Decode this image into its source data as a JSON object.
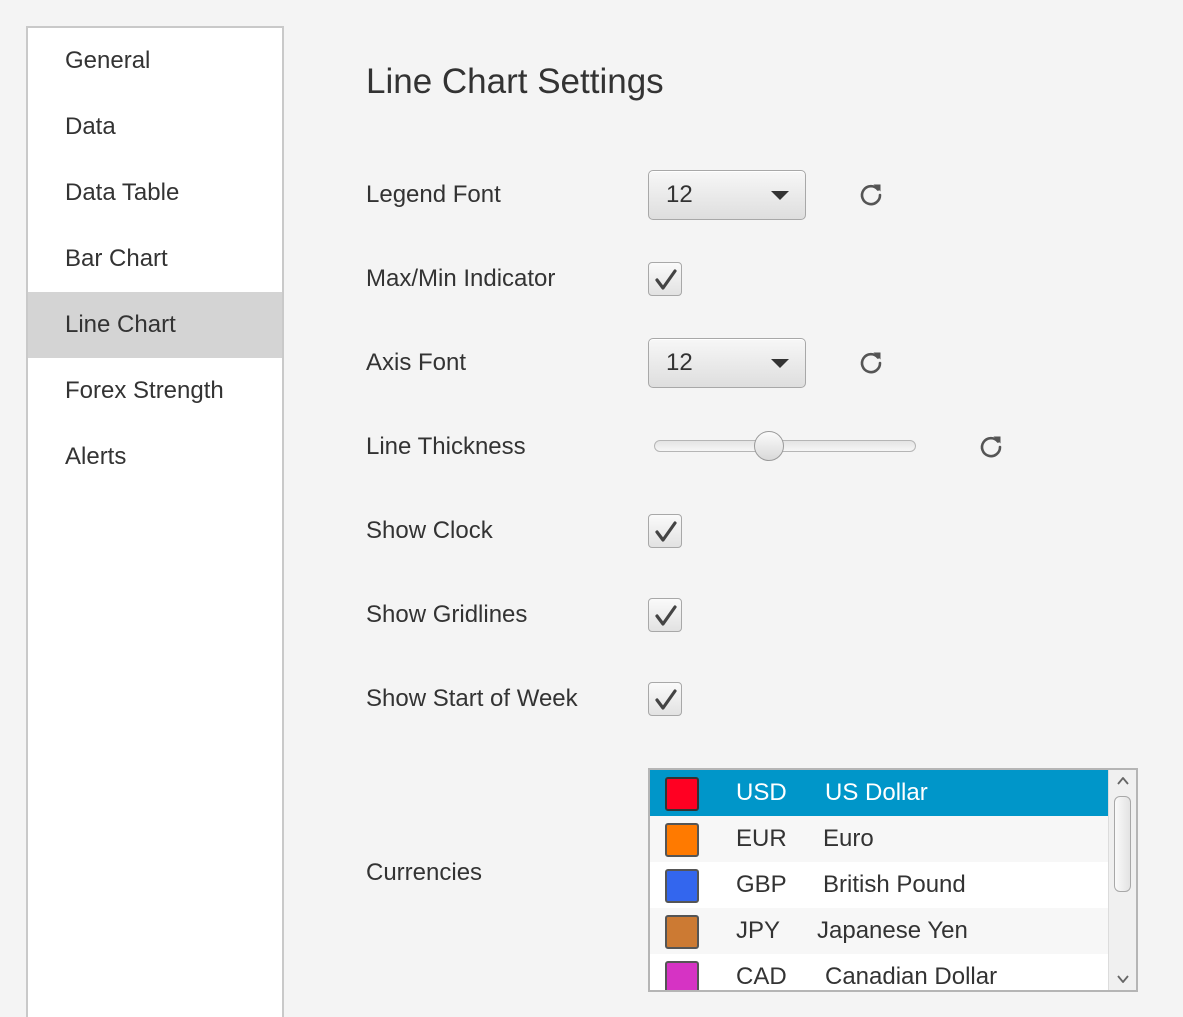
{
  "sidebar": {
    "items": [
      {
        "label": "General",
        "active": false
      },
      {
        "label": "Data",
        "active": false
      },
      {
        "label": "Data Table",
        "active": false
      },
      {
        "label": "Bar Chart",
        "active": false
      },
      {
        "label": "Line Chart",
        "active": true
      },
      {
        "label": "Forex Strength",
        "active": false
      },
      {
        "label": "Alerts",
        "active": false
      }
    ]
  },
  "main": {
    "title": "Line Chart Settings",
    "legend_font": {
      "label": "Legend Font",
      "value": "12",
      "reset_icon": "refresh-icon"
    },
    "max_min_indicator": {
      "label": "Max/Min Indicator",
      "checked": true
    },
    "axis_font": {
      "label": "Axis Font",
      "value": "12",
      "reset_icon": "refresh-icon"
    },
    "line_thickness": {
      "label": "Line Thickness",
      "slider_fraction": 0.44,
      "reset_icon": "refresh-icon"
    },
    "show_clock": {
      "label": "Show Clock",
      "checked": true
    },
    "show_gridlines": {
      "label": "Show Gridlines",
      "checked": true
    },
    "show_start_of_week": {
      "label": "Show Start of Week",
      "checked": true
    },
    "currencies": {
      "label": "Currencies",
      "items": [
        {
          "code": "USD",
          "name": "US Dollar",
          "color": "#ff0022",
          "selected": true
        },
        {
          "code": "EUR",
          "name": "Euro",
          "color": "#ff7a00",
          "selected": false
        },
        {
          "code": "GBP",
          "name": "British Pound",
          "color": "#3366ee",
          "selected": false
        },
        {
          "code": "JPY",
          "name": "Japanese Yen",
          "color": "#cc7a33",
          "selected": false
        },
        {
          "code": "CAD",
          "name": "Canadian Dollar",
          "color": "#d633c4",
          "selected": false
        }
      ]
    }
  },
  "colors": {
    "selection": "#0096c9",
    "sidebar_active": "#d4d4d4",
    "background": "#f4f4f4"
  }
}
